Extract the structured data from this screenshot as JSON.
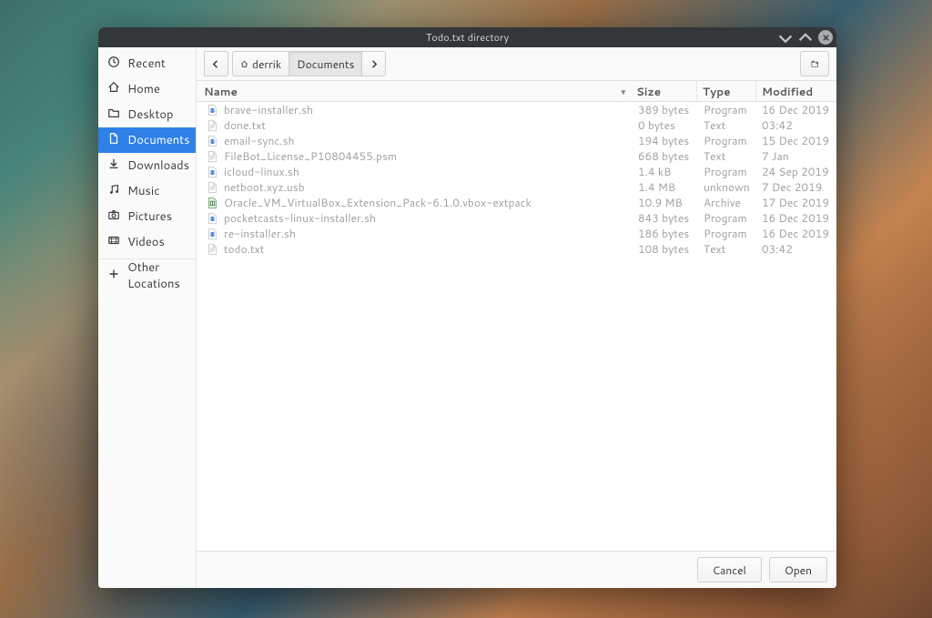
{
  "window": {
    "title": "Todo.txt directory"
  },
  "sidebar": {
    "items": [
      {
        "label": "Recent",
        "icon": "clock-icon",
        "active": false
      },
      {
        "label": "Home",
        "icon": "home-icon",
        "active": false
      },
      {
        "label": "Desktop",
        "icon": "folder-icon",
        "active": false
      },
      {
        "label": "Documents",
        "icon": "document-icon",
        "active": true
      },
      {
        "label": "Downloads",
        "icon": "download-icon",
        "active": false
      },
      {
        "label": "Music",
        "icon": "music-icon",
        "active": false
      },
      {
        "label": "Pictures",
        "icon": "camera-icon",
        "active": false
      },
      {
        "label": "Videos",
        "icon": "video-icon",
        "active": false
      }
    ],
    "other_locations_label": "Other Locations"
  },
  "breadcrumb": {
    "parts": [
      {
        "label": "derrik",
        "home": true,
        "active": false
      },
      {
        "label": "Documents",
        "home": false,
        "active": true
      }
    ]
  },
  "headers": {
    "name": "Name",
    "size": "Size",
    "type": "Type",
    "modified": "Modified"
  },
  "files": [
    {
      "icon": "script",
      "name": "brave-installer.sh",
      "size": "389 bytes",
      "type": "Program",
      "modified": "16 Dec 2019"
    },
    {
      "icon": "text",
      "name": "done.txt",
      "size": "0 bytes",
      "type": "Text",
      "modified": "03:42"
    },
    {
      "icon": "script",
      "name": "email-sync.sh",
      "size": "194 bytes",
      "type": "Program",
      "modified": "15 Dec 2019"
    },
    {
      "icon": "text",
      "name": "FileBot_License_P10804455.psm",
      "size": "668 bytes",
      "type": "Text",
      "modified": "7 Jan"
    },
    {
      "icon": "script",
      "name": "icloud-linux.sh",
      "size": "1.4 kB",
      "type": "Program",
      "modified": "24 Sep 2019"
    },
    {
      "icon": "text",
      "name": "netboot.xyz.usb",
      "size": "1.4 MB",
      "type": "unknown",
      "modified": "7 Dec 2019"
    },
    {
      "icon": "archive",
      "name": "Oracle_VM_VirtualBox_Extension_Pack-6.1.0.vbox-extpack",
      "size": "10.9 MB",
      "type": "Archive",
      "modified": "17 Dec 2019"
    },
    {
      "icon": "script",
      "name": "pocketcasts-linux-installer.sh",
      "size": "843 bytes",
      "type": "Program",
      "modified": "16 Dec 2019"
    },
    {
      "icon": "script",
      "name": "re-installer.sh",
      "size": "186 bytes",
      "type": "Program",
      "modified": "16 Dec 2019"
    },
    {
      "icon": "text",
      "name": "todo.txt",
      "size": "108 bytes",
      "type": "Text",
      "modified": "03:42"
    }
  ],
  "footer": {
    "cancel_label": "Cancel",
    "open_label": "Open"
  }
}
